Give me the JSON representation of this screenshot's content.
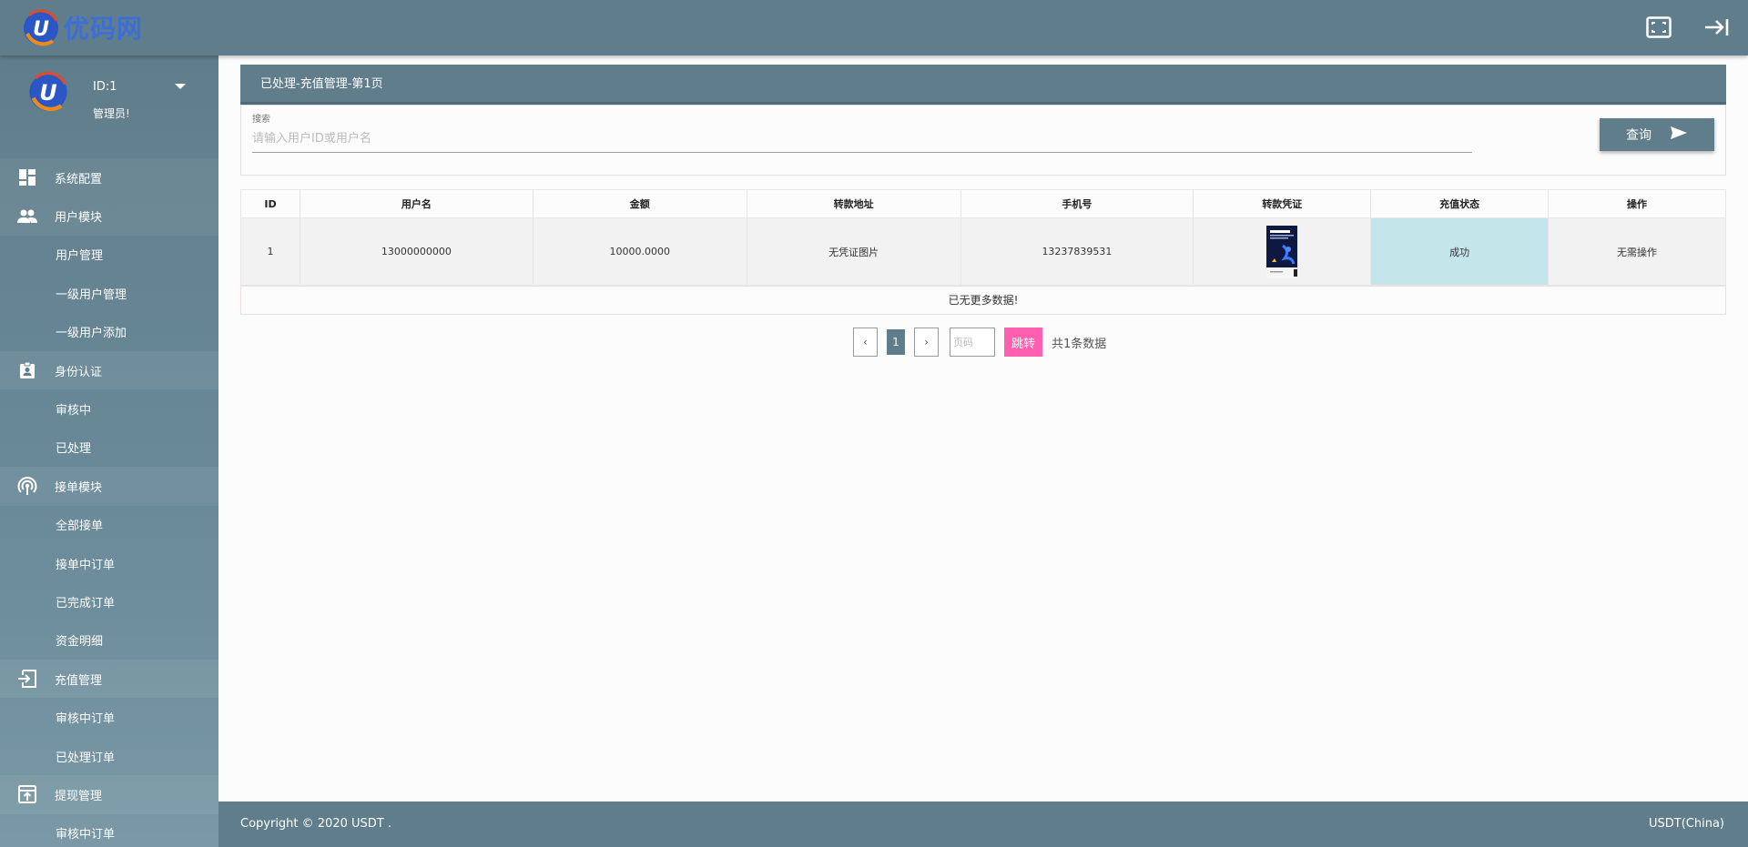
{
  "brand": {
    "logo_text": "优码网",
    "logo_letter": "U"
  },
  "profile": {
    "id": "ID:1",
    "role": "管理员!"
  },
  "sidebar": {
    "items": [
      {
        "label": "系统配置",
        "icon": "dashboard-icon",
        "type": "group"
      },
      {
        "label": "用户模块",
        "icon": "people-icon",
        "type": "group"
      },
      {
        "label": "用户管理",
        "type": "sub"
      },
      {
        "label": "一级用户管理",
        "type": "sub"
      },
      {
        "label": "一级用户添加",
        "type": "sub"
      },
      {
        "label": "身份认证",
        "icon": "id-badge-icon",
        "type": "group"
      },
      {
        "label": "审核中",
        "type": "sub"
      },
      {
        "label": "已处理",
        "type": "sub"
      },
      {
        "label": "接单模块",
        "icon": "signal-icon",
        "type": "group"
      },
      {
        "label": "全部接单",
        "type": "sub"
      },
      {
        "label": "接单中订单",
        "type": "sub"
      },
      {
        "label": "已完成订单",
        "type": "sub"
      },
      {
        "label": "资金明细",
        "type": "sub"
      },
      {
        "label": "充值管理",
        "icon": "login-arrow-icon",
        "type": "group"
      },
      {
        "label": "审核中订单",
        "type": "sub"
      },
      {
        "label": "已处理订单",
        "type": "sub"
      },
      {
        "label": "提现管理",
        "icon": "upload-box-icon",
        "type": "group"
      },
      {
        "label": "审核中订单",
        "type": "sub"
      }
    ]
  },
  "panel": {
    "title": "已处理-充值管理-第1页"
  },
  "search": {
    "label": "搜索",
    "placeholder": "请输入用户ID或用户名",
    "value": "",
    "button_label": "查询"
  },
  "table": {
    "headers": [
      "ID",
      "用户名",
      "金额",
      "转款地址",
      "手机号",
      "转款凭证",
      "充值状态",
      "操作"
    ],
    "rows": [
      {
        "id": "1",
        "username": "13000000000",
        "amount": "10000.0000",
        "address": "无凭证图片",
        "phone": "13237839531",
        "voucher": "image",
        "status": "成功",
        "action": "无需操作"
      }
    ],
    "no_more": "已无更多数据!"
  },
  "pager": {
    "prev": "‹",
    "current_page": "1",
    "next": "›",
    "input_placeholder": "页码",
    "go_label": "跳转",
    "total_text": "共1条数据"
  },
  "footer": {
    "copyright": "Copyright © 2020 USDT .",
    "region": "USDT(China)"
  },
  "colors": {
    "primary": "#607d8b",
    "status_success": "#c4e6ea",
    "go_button": "#ff5fae",
    "logo_blue": "#3b6fd6",
    "logo_orange": "#f08a1c"
  }
}
